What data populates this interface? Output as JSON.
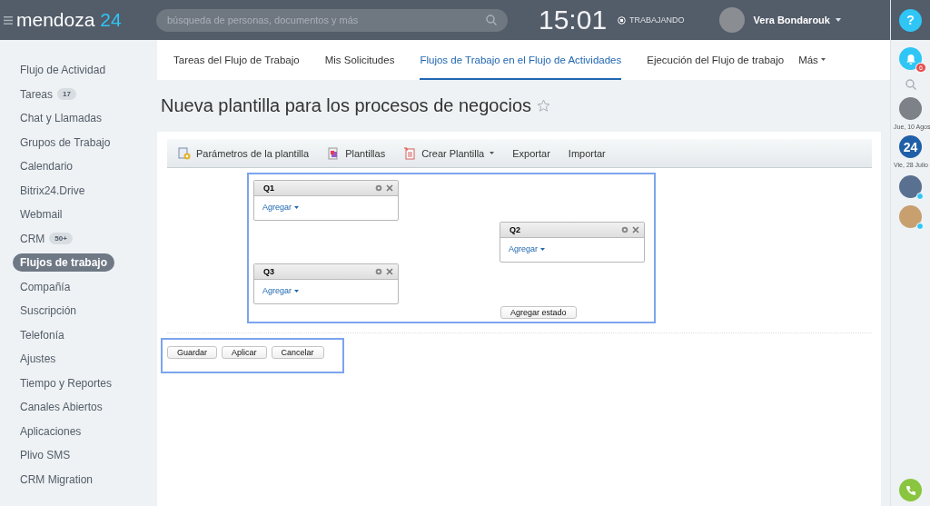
{
  "header": {
    "logo": {
      "name": "mendoza",
      "number": "24"
    },
    "search": {
      "placeholder": "búsqueda de personas, documentos y más"
    },
    "time": "15:01",
    "status": "TRABAJANDO",
    "user": "Vera Bondarouk",
    "help": "?"
  },
  "sidebar": {
    "items": [
      {
        "label": "Flujo de Actividad",
        "selected": false
      },
      {
        "label": "Tareas",
        "counter": "17",
        "selected": false
      },
      {
        "label": "Chat y Llamadas",
        "selected": false
      },
      {
        "label": "Grupos de Trabajo",
        "selected": false
      },
      {
        "label": "Calendario",
        "selected": false
      },
      {
        "label": "Bitrix24.Drive",
        "selected": false
      },
      {
        "label": "Webmail",
        "selected": false
      },
      {
        "label": "CRM",
        "counter": "50+",
        "selected": false
      },
      {
        "label": "Flujos de trabajo",
        "selected": true
      },
      {
        "label": "Compañía",
        "selected": false
      },
      {
        "label": "Suscripción",
        "selected": false
      },
      {
        "label": "Telefonía",
        "selected": false
      },
      {
        "label": "Ajustes",
        "selected": false
      },
      {
        "label": "Tiempo y Reportes",
        "selected": false
      },
      {
        "label": "Canales Abiertos",
        "selected": false
      },
      {
        "label": "Aplicaciones",
        "selected": false
      },
      {
        "label": "Plivo SMS",
        "selected": false
      },
      {
        "label": "CRM Migration",
        "selected": false
      }
    ]
  },
  "tabs": [
    {
      "label": "Tareas del Flujo de Trabajo",
      "selected": false
    },
    {
      "label": "Mis Solicitudes",
      "selected": false
    },
    {
      "label": "Flujos de Trabajo en el Flujo de Actividades",
      "selected": true
    },
    {
      "label": "Ejecución del Flujo de trabajo",
      "selected": false
    }
  ],
  "more_tab": "Más",
  "page_title": "Nueva plantilla para los procesos de negocios",
  "toolbar": [
    {
      "label": "Parámetros de la plantilla",
      "kind": "icon",
      "dropdown": false
    },
    {
      "label": "Plantillas",
      "kind": "icon",
      "dropdown": false
    },
    {
      "label": "Crear Plantilla",
      "kind": "icon",
      "dropdown": true
    },
    {
      "label": "Exportar",
      "kind": "plain",
      "dropdown": false
    },
    {
      "label": "Importar",
      "kind": "plain",
      "dropdown": false
    }
  ],
  "states": [
    {
      "title": "Q1",
      "action": "Agregar"
    },
    {
      "title": "Q2",
      "action": "Agregar"
    },
    {
      "title": "Q3",
      "action": "Agregar"
    }
  ],
  "add_state": "Agregar estado",
  "form_buttons": [
    "Guardar",
    "Aplicar",
    "Cancelar"
  ],
  "right_bar": {
    "notifications": "6",
    "dates": [
      "Jue, 10 Agos",
      "Vie, 28 Julio"
    ],
    "logo_badge": "24"
  }
}
